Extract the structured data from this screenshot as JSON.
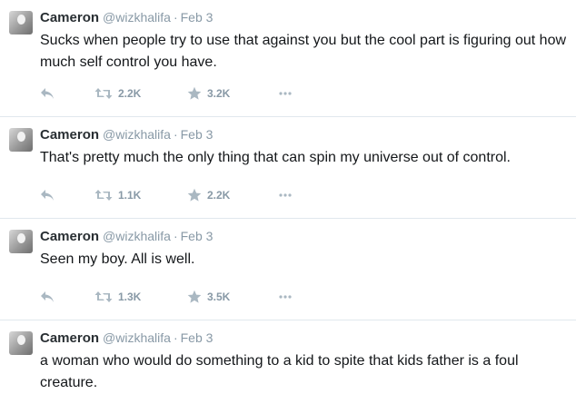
{
  "tweets": [
    {
      "name": "Cameron",
      "handle": "@wizkhalifa",
      "date": "Feb 3",
      "text": "Sucks when people try to use that against you but the cool part is figuring out how much self control you have.",
      "retweets": "2.2K",
      "favorites": "3.2K"
    },
    {
      "name": "Cameron",
      "handle": "@wizkhalifa",
      "date": "Feb 3",
      "text": "That's pretty much the only thing that can spin my universe out of control.",
      "retweets": "1.1K",
      "favorites": "2.2K"
    },
    {
      "name": "Cameron",
      "handle": "@wizkhalifa",
      "date": "Feb 3",
      "text": "Seen my boy. All is well.",
      "retweets": "1.3K",
      "favorites": "3.5K"
    },
    {
      "name": "Cameron",
      "handle": "@wizkhalifa",
      "date": "Feb 3",
      "text": "a woman who would do something to a kid to spite that kids father is a foul creature."
    }
  ],
  "separator": "·",
  "icons": {
    "reply": "reply-icon",
    "retweet": "retweet-icon",
    "favorite": "star-icon",
    "more": "more-icon"
  },
  "colors": {
    "meta_gray": "#8899a6",
    "text": "#14171a",
    "divider": "#e1e8ed"
  }
}
